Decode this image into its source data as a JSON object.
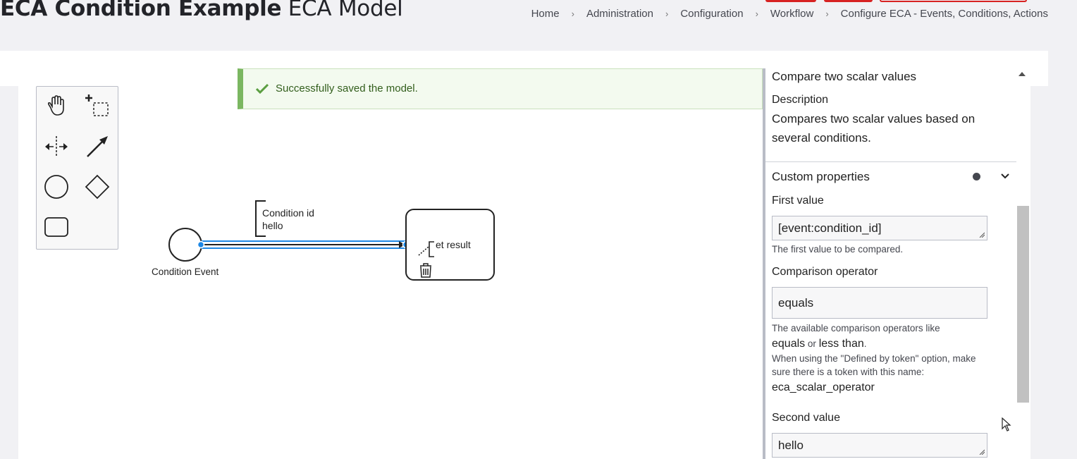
{
  "page": {
    "title_bold": "ECA Condition Example",
    "title_light": "ECA Model"
  },
  "breadcrumb": [
    "Home",
    "Administration",
    "Configuration",
    "Workflow",
    "Configure ECA - Events, Conditions, Actions"
  ],
  "breadcrumb_separator": "›",
  "message": {
    "text": "Successfully saved the model.",
    "icon": "check-icon"
  },
  "palette": {
    "tools": [
      "hand-tool-icon",
      "lasso-tool-icon",
      "space-tool-icon",
      "connect-tool-icon",
      "start-event-icon",
      "gateway-icon",
      "task-icon"
    ]
  },
  "diagram": {
    "start_event_label": "Condition Event",
    "condition_label_line1": "Condition id",
    "condition_label_line2": "hello",
    "task_label": "et result"
  },
  "properties": {
    "heading": "Compare two scalar values",
    "description_label": "Description",
    "description_text": "Compares two scalar values based on several conditions.",
    "custom_properties_label": "Custom properties",
    "first_value_label": "First value",
    "first_value": "[event:condition_id]",
    "first_value_help": "The first value to be compared.",
    "operator_label": "Comparison operator",
    "operator_value": "equals",
    "operator_help_line1": "The available comparison operators like",
    "operator_help_code1": "equals",
    "operator_help_or": "or",
    "operator_help_code2": "less than",
    "operator_help_line2": "When using the \"Defined by token\" option, make sure there is a token with this name:",
    "operator_help_token": "eca_scalar_operator",
    "second_value_label": "Second value",
    "second_value": "hello"
  },
  "colors": {
    "accent": "#d72222",
    "selection": "#1e88e5",
    "success_border": "#7bb761",
    "success_text": "#325e1c"
  }
}
